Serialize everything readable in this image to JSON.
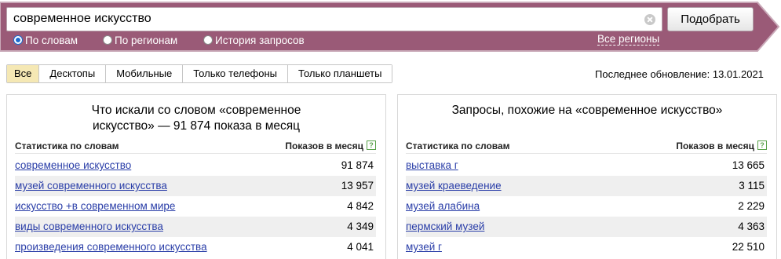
{
  "search": {
    "query": "современное искусство",
    "submit_label": "Подобрать"
  },
  "modes": [
    {
      "label": "По словам",
      "selected": true
    },
    {
      "label": "По регионам",
      "selected": false
    },
    {
      "label": "История запросов",
      "selected": false
    }
  ],
  "regions_link": "Все регионы",
  "device_tabs": [
    {
      "label": "Все",
      "active": true
    },
    {
      "label": "Десктопы",
      "active": false
    },
    {
      "label": "Мобильные",
      "active": false
    },
    {
      "label": "Только телефоны",
      "active": false
    },
    {
      "label": "Только планшеты",
      "active": false
    }
  ],
  "last_update": "Последнее обновление: 13.01.2021",
  "left_panel": {
    "title_line1": "Что искали со словом «современное",
    "title_line2": "искусство» — 91 874 показа в месяц",
    "col_keyword": "Статистика по словам",
    "col_count": "Показов в месяц",
    "help": "?",
    "rows": [
      {
        "keyword": "современное искусство",
        "count": "91 874"
      },
      {
        "keyword": "музей современного искусства",
        "count": "13 957"
      },
      {
        "keyword": "искусство +в современном мире",
        "count": "4 842"
      },
      {
        "keyword": "виды современного искусства",
        "count": "4 349"
      },
      {
        "keyword": "произведения современного искусства",
        "count": "4 041"
      }
    ]
  },
  "right_panel": {
    "title_line1": "Запросы, похожие на «современное искусство»",
    "col_keyword": "Статистика по словам",
    "col_count": "Показов в месяц",
    "help": "?",
    "rows": [
      {
        "keyword": "выставка г",
        "count": "13 665"
      },
      {
        "keyword": "музей краеведение",
        "count": "3 115"
      },
      {
        "keyword": "музей алабина",
        "count": "2 229"
      },
      {
        "keyword": "пермский музей",
        "count": "4 363"
      },
      {
        "keyword": "музей г",
        "count": "22 510"
      }
    ]
  },
  "colors": {
    "header_band": "#9a5a77",
    "header_border": "#c9a9b8",
    "link": "#2a3ea8",
    "active_tab": "#f5e8b4",
    "alt_row": "#efefef"
  }
}
